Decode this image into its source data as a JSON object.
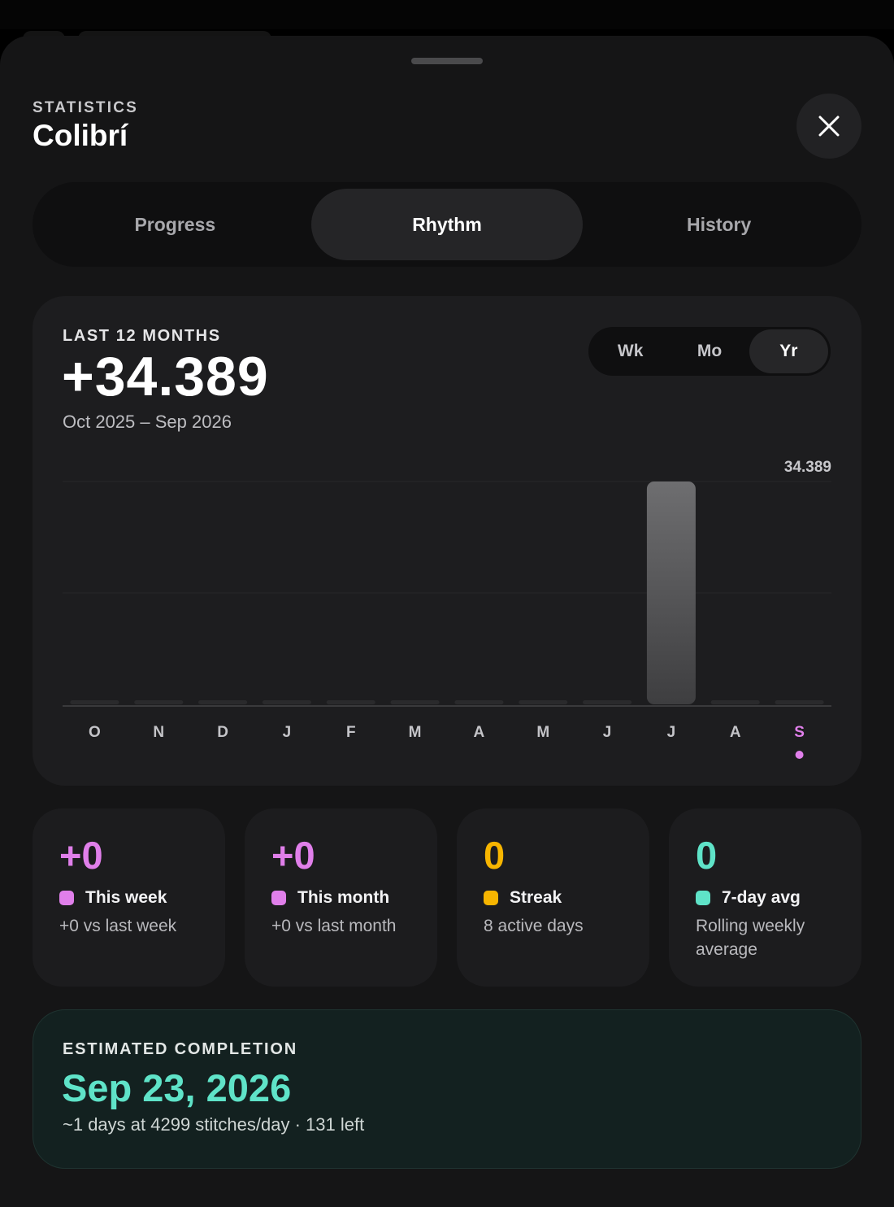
{
  "header": {
    "eyebrow": "STATISTICS",
    "title": "Colibrí"
  },
  "tabs": [
    {
      "label": "Progress",
      "active": false
    },
    {
      "label": "Rhythm",
      "active": true
    },
    {
      "label": "History",
      "active": false
    }
  ],
  "summary": {
    "eyebrow": "LAST 12 MONTHS",
    "value": "+34.389",
    "range": "Oct 2025 – Sep 2026"
  },
  "range_toggle": [
    {
      "label": "Wk",
      "active": false
    },
    {
      "label": "Mo",
      "active": false
    },
    {
      "label": "Yr",
      "active": true
    }
  ],
  "chart_data": {
    "type": "bar",
    "categories": [
      "O",
      "N",
      "D",
      "J",
      "F",
      "M",
      "A",
      "M",
      "J",
      "J",
      "A",
      "S"
    ],
    "values": [
      0,
      0,
      0,
      0,
      0,
      0,
      0,
      0,
      0,
      34389,
      0,
      0
    ],
    "max_label": "34.389",
    "ylim": [
      0,
      34389
    ],
    "highlight_index": 11,
    "grid": true,
    "colors": {
      "bar": "#6b6b6d",
      "baseline_stub": "#2a2a2c",
      "highlight": "#e07fea"
    }
  },
  "stats": [
    {
      "value": "+0",
      "label": "This week",
      "sub": "+0 vs last week",
      "color": "#e07fea"
    },
    {
      "value": "+0",
      "label": "This month",
      "sub": "+0 vs last month",
      "color": "#e07fea"
    },
    {
      "value": "0",
      "label": "Streak",
      "sub": "8 active days",
      "color": "#f7b500"
    },
    {
      "value": "0",
      "label": "7-day avg",
      "sub": "Rolling weekly average",
      "color": "#5fe3c8"
    }
  ],
  "eta": {
    "eyebrow": "ESTIMATED COMPLETION",
    "date": "Sep 23, 2026",
    "sub": "~1 days at 4299 stitches/day · 131 left",
    "color": "#5fe3c8"
  },
  "icons": {
    "close": "close-icon"
  }
}
